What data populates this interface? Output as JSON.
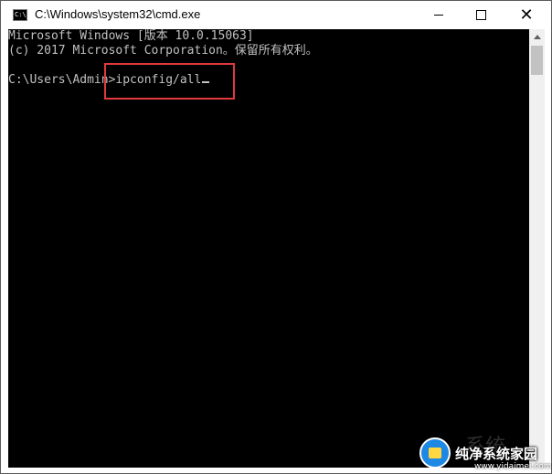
{
  "window": {
    "title": "C:\\Windows\\system32\\cmd.exe",
    "icon": "cmd-icon"
  },
  "console": {
    "lines": [
      "Microsoft Windows [版本 10.0.15063]",
      "(c) 2017 Microsoft Corporation。保留所有权利。"
    ],
    "prompt": "C:\\Users\\Admin>",
    "command": "ipconfig/all",
    "text_color": "#c0c0c0",
    "background": "#000000",
    "highlight_color": "#e0393e"
  },
  "controls": {
    "minimize_icon": "minimize-icon",
    "maximize_icon": "maximize-icon",
    "close_icon": "close-icon",
    "close_glyph": "✕"
  },
  "watermark": {
    "faint": "系统",
    "name": "纯净系统家园",
    "url": "www.yidaimei.com"
  }
}
